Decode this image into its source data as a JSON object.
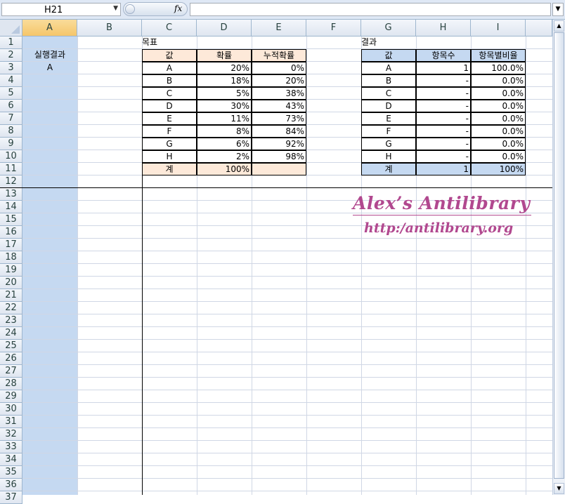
{
  "formula_bar": {
    "name_box": "H21",
    "fx_label": "fx",
    "formula": ""
  },
  "columns": [
    "A",
    "B",
    "C",
    "D",
    "E",
    "F",
    "G",
    "H",
    "I"
  ],
  "rows": [
    "1",
    "2",
    "3",
    "4",
    "5",
    "6",
    "7",
    "8",
    "9",
    "10",
    "11",
    "12",
    "13",
    "14",
    "15",
    "16",
    "17",
    "18",
    "19",
    "20",
    "21",
    "22",
    "23",
    "24",
    "25",
    "26",
    "27",
    "28",
    "29",
    "30",
    "31",
    "32",
    "33",
    "34",
    "35",
    "36",
    "37"
  ],
  "cells": {
    "a2": "실행결과",
    "a3": "A",
    "c1": "목표",
    "g1": "결과",
    "left_table": {
      "headers": [
        "값",
        "확률",
        "누적확률"
      ],
      "rows": [
        [
          "A",
          "20%",
          "0%"
        ],
        [
          "B",
          "18%",
          "20%"
        ],
        [
          "C",
          "5%",
          "38%"
        ],
        [
          "D",
          "30%",
          "43%"
        ],
        [
          "E",
          "11%",
          "73%"
        ],
        [
          "F",
          "8%",
          "84%"
        ],
        [
          "G",
          "6%",
          "92%"
        ],
        [
          "H",
          "2%",
          "98%"
        ]
      ],
      "total": [
        "계",
        "100%",
        ""
      ]
    },
    "right_table": {
      "headers": [
        "값",
        "항목수",
        "항목별비율"
      ],
      "rows": [
        [
          "A",
          "1",
          "100.0%"
        ],
        [
          "B",
          "-",
          "0.0%"
        ],
        [
          "C",
          "-",
          "0.0%"
        ],
        [
          "D",
          "-",
          "0.0%"
        ],
        [
          "E",
          "-",
          "0.0%"
        ],
        [
          "F",
          "-",
          "0.0%"
        ],
        [
          "G",
          "-",
          "0.0%"
        ],
        [
          "H",
          "-",
          "0.0%"
        ]
      ],
      "total": [
        "계",
        "1",
        "100%"
      ]
    }
  },
  "watermark": {
    "line1": "Alex’s Antilibrary",
    "line2": "http:/antilibrary.org"
  },
  "colors": {
    "peach": "#fde9d9",
    "light_blue": "#c5d9f1",
    "watermark": "#b1488f",
    "grid": "#d0d7e5"
  }
}
